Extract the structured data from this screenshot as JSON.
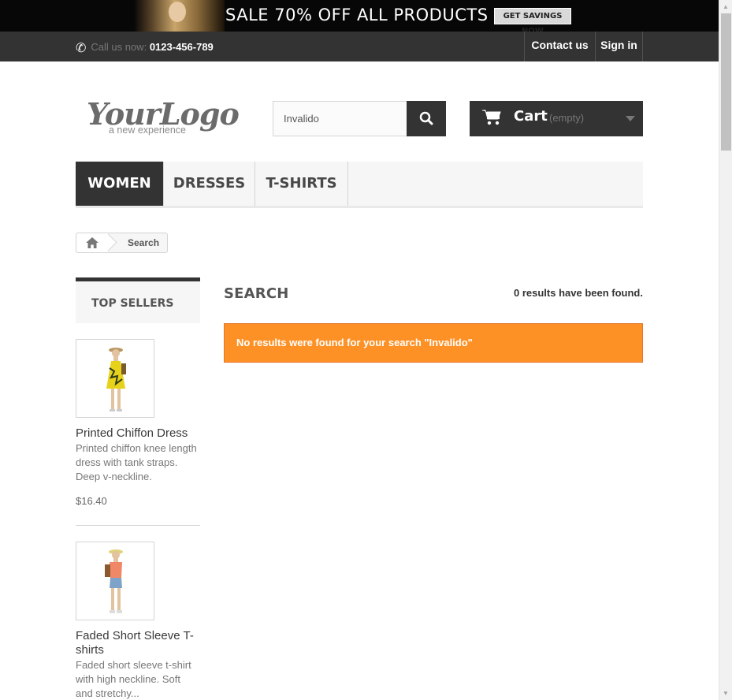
{
  "banner": {
    "text": "SALE 70% OFF ALL PRODUCTS",
    "button": "GET SAVINGS NOW"
  },
  "topbar": {
    "call_prefix": "Call us now: ",
    "phone": "0123-456-789",
    "contact": "Contact us",
    "signin": "Sign in"
  },
  "logo": {
    "script": "YourLogo",
    "tagline": "a new experience"
  },
  "search": {
    "value": "Invalido",
    "icon": "search-icon"
  },
  "cart": {
    "label": "Cart",
    "status": "(empty)"
  },
  "menu": {
    "items": [
      {
        "label": "WOMEN",
        "active": true
      },
      {
        "label": "DRESSES",
        "active": false
      },
      {
        "label": "T-SHIRTS",
        "active": false
      }
    ]
  },
  "breadcrumb": {
    "current": "Search"
  },
  "sidebar": {
    "title": "TOP SELLERS",
    "products": [
      {
        "name": "Printed Chiffon Dress",
        "description": "Printed chiffon knee length dress with tank straps. Deep v-neckline.",
        "price": "$16.40"
      },
      {
        "name": "Faded Short Sleeve T-shirts",
        "description": "Faded short sleeve t-shirt with high neckline. Soft and stretchy..."
      }
    ]
  },
  "main": {
    "heading": "SEARCH",
    "result_count": "0 results have been found.",
    "alert": "No results were found for your search \"Invalido\""
  },
  "colors": {
    "dark": "#333333",
    "alert": "#fe9126",
    "menu_bg": "#f6f6f6"
  }
}
